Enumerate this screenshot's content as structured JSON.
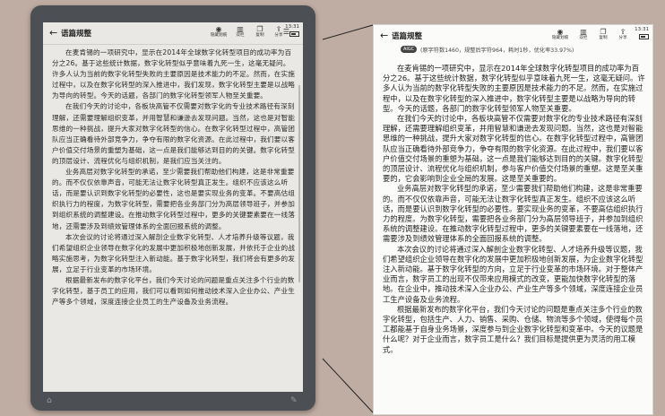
{
  "toolbar": {
    "title": "语篇规整",
    "back_icon": "arrow-left-icon",
    "buttons": [
      {
        "label": "隐藏划痕",
        "icon": "eye-icon"
      },
      {
        "label": "双栏"
      },
      {
        "label": "复制"
      },
      {
        "label": "分享"
      }
    ],
    "time": "13:31"
  },
  "stats": {
    "badge": "AIGC",
    "text": "(原字符数1460，规整后字符964，耗时1秒，优化率33.97%)"
  },
  "paragraphs": [
    "在麦肯锡的一项研究中，显示在2014年全球数字化转型项目的成功率为百分之26。基于这些统计数据，数字化转型似乎意味着九死一生，这毫无疑问。许多人认为当前的数字化转型失败的主要原因是技术能力的不足。然而，在实施过程中，以及在数字化转型的深入推进中，我们发现，数字化转型主要是以战略为导向的转型。今天的话题，各部门的数字化转型领军人物至关重要。",
    "在我们今天的讨论中，各板块高管不仅需要对数字化的专业技术路径有深刻理解，还需要理解组织变革，并用智慧和谦逊去发现问题。当然，这也是对智能思维的一种挑战，提升大家对数字化转型的信心。在数字化转型过程中，高管团队应当正确看待外部竞争力，争夺有限的数字化资源。在此过程中，我们要以客户价值交付场景的重塑为基础，这一点是我们能够达到目的的关键。数字化转型的顶层设计、流程优化与组织机制，是我们应当关注的。",
    "业务高层对数字化转型的承诺，至少需要我们帮助他们构建，这是非常重要的。而不仅仅依靠声音，可能无法让数字化转型真正发生。组织不应该这么听话，而是要认识到数字化转型的必要性，这也是要实现业务的变革。不要高估组织执行力的程度，为数字化转型，需要把各业务部门分为高层领导班子，并参加到组织系统的调整建设。在推动数字化转型过程中，更多的关键要素要在一线落地，还需要涉及到绩效管理体系的全面回报系统的调整。",
    "本次会议的讨论将通过深入解剖企业数字化转型、人才培养升级等议题，我们希望组织企业领导在数字化的发展中更加积极地创新发展，并依托于企业的战略实施思考，为数字化转型注入新动能。基于数字化转型，我们将会有更多的发展，立足于行业变革的市场环境。",
    "根据最新发布的数字化平台，我们今天讨论的问题是重点关注多个行业的数字化转型，基于员工的应用，我们可以看到如何推动技术深入企业办公、产业生产等多个领域，深度连接企业员工的生产设备及业务流程。"
  ],
  "zoom_paragraphs": [
    "在麦肯锡的一项研究中，显示在2014年全球数字化转型项目的成功率为百分之26。基于这些统计数据，数字化转型似乎意味着九死一生，这毫无疑问。许多人认为当前的数字化转型失败的主要原因是技术能力的不足。然而，在实施过程中，以及在数字化转型的深入推进中，数字化转型主要是以战略为导向的转型。今天的话题，各部门的数字化转型领军人物至关重要。",
    "在我们今天的讨论中，各板块高管不仅需要对数字化的专业技术路径有深刻理解，还需要理解组织变革，并用智慧和谦逊去发现问题。当然，这也是对智能思维的一种挑战，提升大家对数字化转型的信心。在数字化转型过程中，高管团队应当正确看待外部竞争力，争夺有限的数字化资源。在此过程中，我们要以客户价值交付场景的重塑为基础，这一点是我们能够达到目的的关键。数字化转型的顶层设计、流程优化与组织机制，参与客户价值交付场景的重塑。这是至关重要的，它会影响到企业全局的发展。这是至关重要的。",
    "业务高层对数字化转型的承诺，至少需要我们帮助他们构建，这是非常重要的。而不仅仅依靠声音，可能无法让数字化转型真正发生。组织不应该这么听话，而是要认识到数字化转型的必要性。要实现业务的变革，不要高估组织执行力的程度。为数字化转型，需要把各业务部门分为高层领导班子，并参加到组织系统的调整建设。在推动数字化转型过程中，更多的关键要素要在一线落地，还需要涉及到绩效管理体系的全面回报系统的调整。",
    "本次会议的讨论将通过深入解剖企业数字化转型、人才培养升级等议题，我们希望组织企业领导在数字化的发展中更加积极地创新发展，为企业数字化转型注入新动能。基于数字化转型的方向，立足于行业变革的市场环境。对于整体产业而言，数字员工的出现不仅带来应用模式的改变，更能加快数字化转型的落地。在企业中，推动技术深入企业办公、产业生产等多个领域，深度连接企业员工生产设备及业务流程。",
    "根据最新发布的数字化平台，我们今天讨论的问题是重点关注多个行业的数字化转型，包括生产、人力、销售、采购、仓储、物流等多个领域，使得每个员工都能基于自身业务场景，深度参与到企业数字化转型和变革中。今天的议题是什么呢？对于企业而言，数字员工是什么？我们目标是提供更为灵活的用工模式。"
  ]
}
